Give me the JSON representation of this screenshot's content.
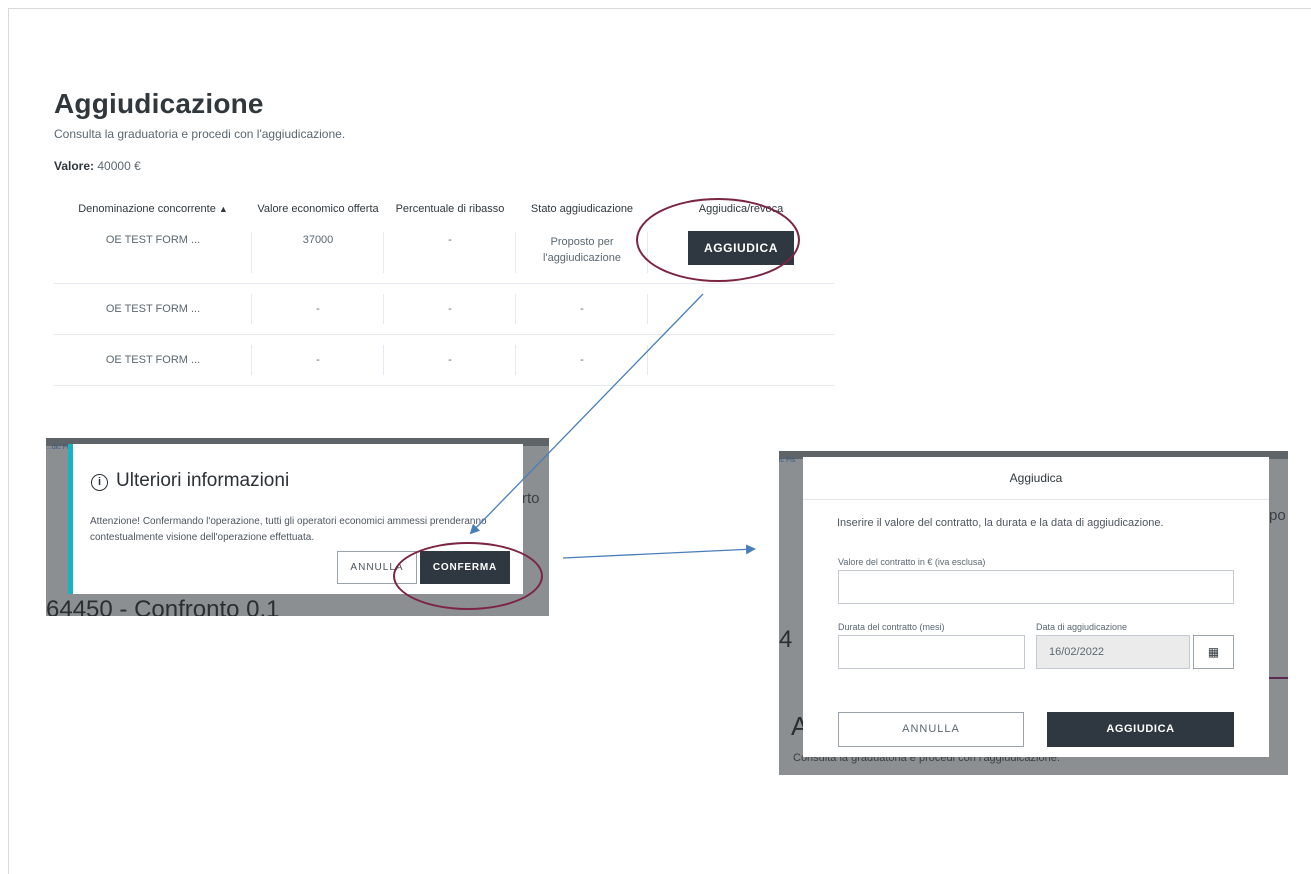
{
  "page": {
    "title": "Aggiudicazione",
    "subtitle": "Consulta la graduatoria e procedi con l'aggiudicazione.",
    "value_label": "Valore:",
    "value_amount": "40000 €"
  },
  "table": {
    "headers": [
      "Denominazione concorrente",
      "Valore economico offerta",
      "Percentuale di ribasso",
      "Stato aggiudicazione",
      "Aggiudica/revoca"
    ],
    "sort_icon": "▲",
    "rows": [
      {
        "name": "OE TEST FORM ...",
        "value": "37000",
        "discount": "-",
        "status": "Proposto per l'aggiudicazione",
        "action": "AGGIUDICA"
      },
      {
        "name": "OE TEST FORM ...",
        "value": "-",
        "discount": "-",
        "status": "-",
        "action": ""
      },
      {
        "name": "OE TEST FORM ...",
        "value": "-",
        "discount": "-",
        "status": "-",
        "action": ""
      }
    ]
  },
  "confirm_modal": {
    "title": "Ulteriori informazioni",
    "info_icon": "i",
    "text": "Attenzione! Confermando l'operazione, tutti gli operatori economici ammessi prenderanno contestualmente visione dell'operazione effettuata.",
    "cancel_label": "ANNULLA",
    "confirm_label": "CONFERMA",
    "bg_link": "...dic Fis",
    "bg_peek": "rto",
    "bg_heading": "64450 - Confronto 0.1",
    "accent_color": "#1ab1c4"
  },
  "award_modal": {
    "title": "Aggiudica",
    "intro": "Inserire il valore del contratto, la durata e la data di aggiudicazione.",
    "contract_value_label": "Valore del contratto in € (iva esclusa)",
    "contract_value": "",
    "duration_label": "Durata del contratto (mesi)",
    "duration_value": "",
    "award_date_label": "Data di aggiudicazione",
    "award_date_value": "16/02/2022",
    "calendar_icon": "▦",
    "cancel_label": "ANNULLA",
    "submit_label": "AGGIUDICA",
    "bg_link": "ic Fis",
    "bg_peek": "po",
    "bg_num": "4",
    "bg_big": "A",
    "bg_sub": "Consulta la graduatoria e procedi con l'aggiudicazione."
  },
  "annotations": {
    "highlight_color": "#7b2443",
    "arrow_color": "#4a7ebb"
  }
}
